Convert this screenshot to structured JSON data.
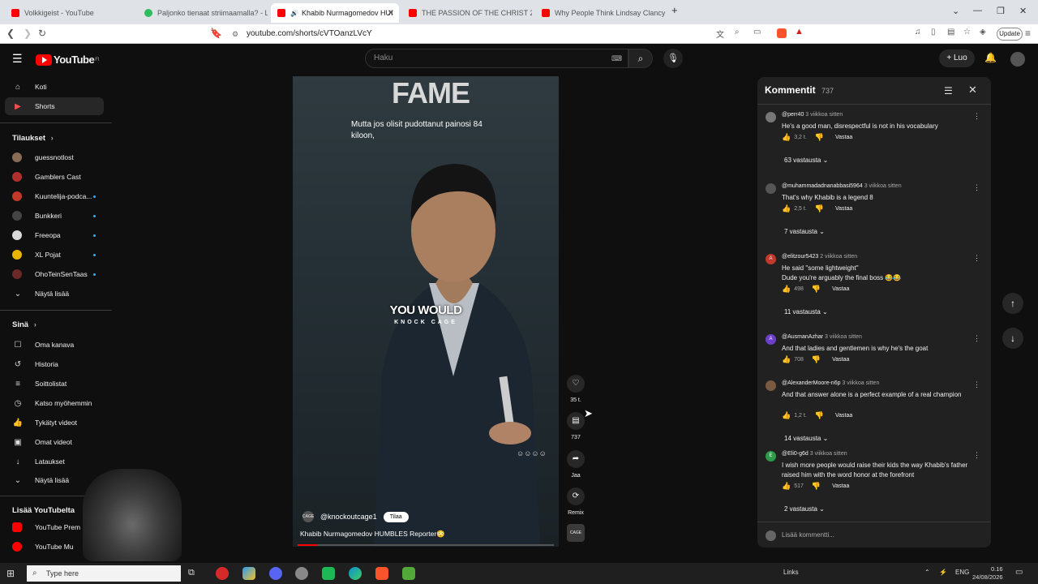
{
  "browser": {
    "tabs": [
      {
        "title": "Volkkigeist - YouTube",
        "color": "#ff0000"
      },
      {
        "title": "Paljonko tienaat striimaamalla? - Le",
        "color": "#2fbe5f"
      },
      {
        "title": "Khabib Nurmagomedov HUI",
        "color": "#ff0000"
      },
      {
        "title": "THE PASSION OF THE CHRIST 2: Res",
        "color": "#ff0000"
      },
      {
        "title": "Why People Think Lindsay Clancy's H",
        "color": "#ff0000"
      }
    ],
    "new_tab": "+",
    "url": "youtube.com/shorts/cVTOanzLVcY",
    "update_label": "Update"
  },
  "youtube": {
    "logo_text": "YouTube",
    "logo_sup": "FI",
    "search_placeholder": "Haku",
    "create_label": "Luo"
  },
  "sidebar": {
    "main": [
      {
        "label": "Koti",
        "icon": "home-icon",
        "glyph": "⌂"
      },
      {
        "label": "Shorts",
        "icon": "shorts-icon",
        "glyph": "▶"
      }
    ],
    "subscriptions_heading": "Tilaukset",
    "subscriptions": [
      {
        "label": "guessnotlost",
        "color": "#8a6b55",
        "dot": false
      },
      {
        "label": "Gamblers Cast",
        "color": "#b03030",
        "dot": false
      },
      {
        "label": "Kuuntelija-podca...",
        "color": "#c0392b",
        "dot": true
      },
      {
        "label": "Bunkkeri",
        "color": "#444444",
        "dot": true
      },
      {
        "label": "Freeopa",
        "color": "#d9d9d9",
        "dot": true
      },
      {
        "label": "XL Pojat",
        "color": "#e8b400",
        "dot": true
      },
      {
        "label": "OhoTeinSenTaas",
        "color": "#6b2a2a",
        "dot": true
      }
    ],
    "show_more_1": "Näytä lisää",
    "you_heading": "Sinä",
    "you_items": [
      {
        "label": "Oma kanava",
        "icon": "channel-icon",
        "glyph": "☐"
      },
      {
        "label": "Historia",
        "icon": "history-icon",
        "glyph": "↺"
      },
      {
        "label": "Soittolistat",
        "icon": "playlists-icon",
        "glyph": "≡"
      },
      {
        "label": "Katso myöhemmin",
        "icon": "watch-later-icon",
        "glyph": "◷"
      },
      {
        "label": "Tykätyt videot",
        "icon": "like-icon",
        "glyph": "👍"
      },
      {
        "label": "Omat videot",
        "icon": "your-videos-icon",
        "glyph": "▣"
      },
      {
        "label": "Lataukset",
        "icon": "download-icon",
        "glyph": "↓"
      }
    ],
    "show_more_2": "Näytä lisää",
    "more_heading": "Lisää YouTubelta",
    "more_items": [
      {
        "label": "YouTube Prem",
        "color": "#ff0000"
      },
      {
        "label": "YouTube Mu",
        "color": "#ff0000"
      }
    ]
  },
  "video": {
    "overlay_top": "FAME",
    "subtitle": "Mutta jos olisit pudottanut painosi 84 kiloon,",
    "caption_line1": "YOU WOULD",
    "caption_line2": "KNOCK CAGE",
    "channel": "@knockoutcage1",
    "channel_avatar": "CAGE",
    "subscribe": "Tilaa",
    "title": "Khabib Nurmagomedov HUMBLES Reporter😳",
    "progress": 0.08
  },
  "actions": {
    "likes": "35 t.",
    "comments": "737",
    "share": "Jaa",
    "remix": "Remix",
    "sound_avatar": "CAGE"
  },
  "comments": {
    "heading": "Kommentit",
    "count": "737",
    "add_placeholder": "Lisää kommentti...",
    "reply_label": "Vastaa",
    "items": [
      {
        "user": "@perr40",
        "time": "3 viikkoa sitten",
        "text": "He's a good man, disrespectful is not in his vocabulary",
        "likes": "3,2 t.",
        "replies": "63 vastausta",
        "avatar_color": "#777777",
        "avatar_letter": ""
      },
      {
        "user": "@muhammadadnanabbasi5964",
        "time": "3 viikkoa sitten",
        "text": "That's why Khabib is a legend 8",
        "likes": "2,5 t.",
        "replies": "7 vastausta",
        "avatar_color": "#555555",
        "avatar_letter": ""
      },
      {
        "user": "@elitzour5423",
        "time": "2 viikkoa sitten",
        "text": "He said \"some lightweight\"\nDude you're arguably the final boss 😂😂",
        "likes": "498",
        "replies": "11 vastausta",
        "avatar_color": "#c0392b",
        "avatar_letter": "A"
      },
      {
        "user": "@AusmanAzhar",
        "time": "3 viikkoa sitten",
        "text": "And that ladies and gentlemen is why he's the goat",
        "likes": "708",
        "replies": "",
        "avatar_color": "#6a3fc9",
        "avatar_letter": "A"
      },
      {
        "user": "@AlexanderMoore-n6p",
        "time": "3 viikkoa sitten",
        "text": "And that answer alone is a perfect example of a real champion",
        "likes": "1,2 t.",
        "replies": "14 vastausta",
        "avatar_color": "#7a5a40",
        "avatar_letter": ""
      },
      {
        "user": "@Eli0-g6d",
        "time": "3 viikkoa sitten",
        "text": "I wish more people would raise their kids the way Khabib's father raised him with the word honor at the forefront",
        "likes": "517",
        "replies": "2 vastausta",
        "avatar_color": "#2e9a4a",
        "avatar_letter": "E"
      }
    ]
  },
  "taskbar": {
    "search_placeholder": "Type here",
    "links_label": "Links",
    "lang": "ENG",
    "time": "0.16",
    "date": "24/08/2026"
  }
}
